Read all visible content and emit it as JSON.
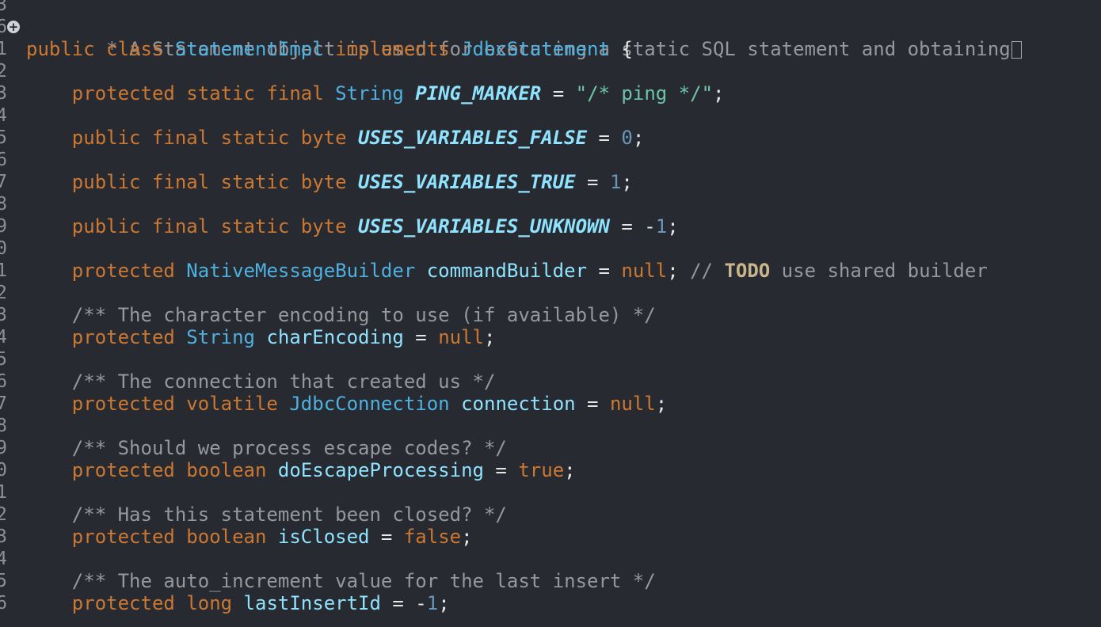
{
  "gutter": {
    "fold_icon": "fold-expand-icon",
    "line_digits": [
      "3",
      "6",
      "1",
      "2",
      "3",
      "4",
      "5",
      "6",
      "7",
      "8",
      "9",
      "0",
      "1",
      "2",
      "3",
      "4",
      "5",
      "6",
      "7",
      "8",
      "9",
      "0",
      "1",
      "2",
      "3",
      "4",
      "5",
      "6"
    ]
  },
  "code": {
    "l1": {
      "comment": " * A Statement object is used for executing a static SQL statement and obtaining"
    },
    "l2": {
      "kw1": "public",
      "kw2": "class",
      "type": "StatementImpl",
      "kw3": "implements",
      "iface": "JdbcStatement",
      "brace": " {"
    },
    "l4": {
      "kw1": "protected",
      "kw2": "static",
      "kw3": "final",
      "type": "String",
      "name": "PING_MARKER",
      "eq": " = ",
      "value": "\"/* ping */\"",
      "semi": ";"
    },
    "l6": {
      "kw": "public final static byte",
      "name": "USES_VARIABLES_FALSE",
      "eq": " = ",
      "value": "0",
      "semi": ";"
    },
    "l8": {
      "kw": "public final static byte",
      "name": "USES_VARIABLES_TRUE",
      "eq": " = ",
      "value": "1",
      "semi": ";"
    },
    "l10": {
      "kw": "public final static byte",
      "name": "USES_VARIABLES_UNKNOWN",
      "eq": " = ",
      "minus": "-",
      "value": "1",
      "semi": ";"
    },
    "l12": {
      "kw": "protected",
      "type": "NativeMessageBuilder",
      "name": "commandBuilder",
      "eq": " = ",
      "value": "null",
      "semi": ";",
      "cm_start": " // ",
      "todo": "TODO",
      "cm_rest": " use shared builder"
    },
    "l14": {
      "comment": "/** The character encoding to use (if available) */"
    },
    "l15": {
      "kw": "protected",
      "type": "String",
      "name": "charEncoding",
      "eq": " = ",
      "value": "null",
      "semi": ";"
    },
    "l17": {
      "comment": "/** The connection that created us */"
    },
    "l18": {
      "kw": "protected volatile",
      "type": "JdbcConnection",
      "name": "connection",
      "eq": " = ",
      "value": "null",
      "semi": ";"
    },
    "l20": {
      "comment": "/** Should we process escape codes? */"
    },
    "l21": {
      "kw": "protected boolean",
      "name": "doEscapeProcessing",
      "eq": " = ",
      "value": "true",
      "semi": ";"
    },
    "l23": {
      "comment": "/** Has this statement been closed? */"
    },
    "l24": {
      "kw": "protected boolean",
      "name": "isClosed",
      "eq": " = ",
      "value": "false",
      "semi": ";"
    },
    "l26": {
      "comment": "/** The auto_increment value for the last insert */"
    },
    "l27": {
      "kw": "protected long",
      "name": "lastInsertId",
      "eq": " = ",
      "minus": "-",
      "value": "1",
      "semi": ";"
    }
  },
  "colors": {
    "background": "#272b31",
    "keyword": "#cc7832",
    "type": "#4eb1e0",
    "field": "#8fe3ff",
    "string": "#6cc6a6",
    "number": "#6897bb",
    "comment": "#96989c",
    "todo": "#c9b58c"
  }
}
